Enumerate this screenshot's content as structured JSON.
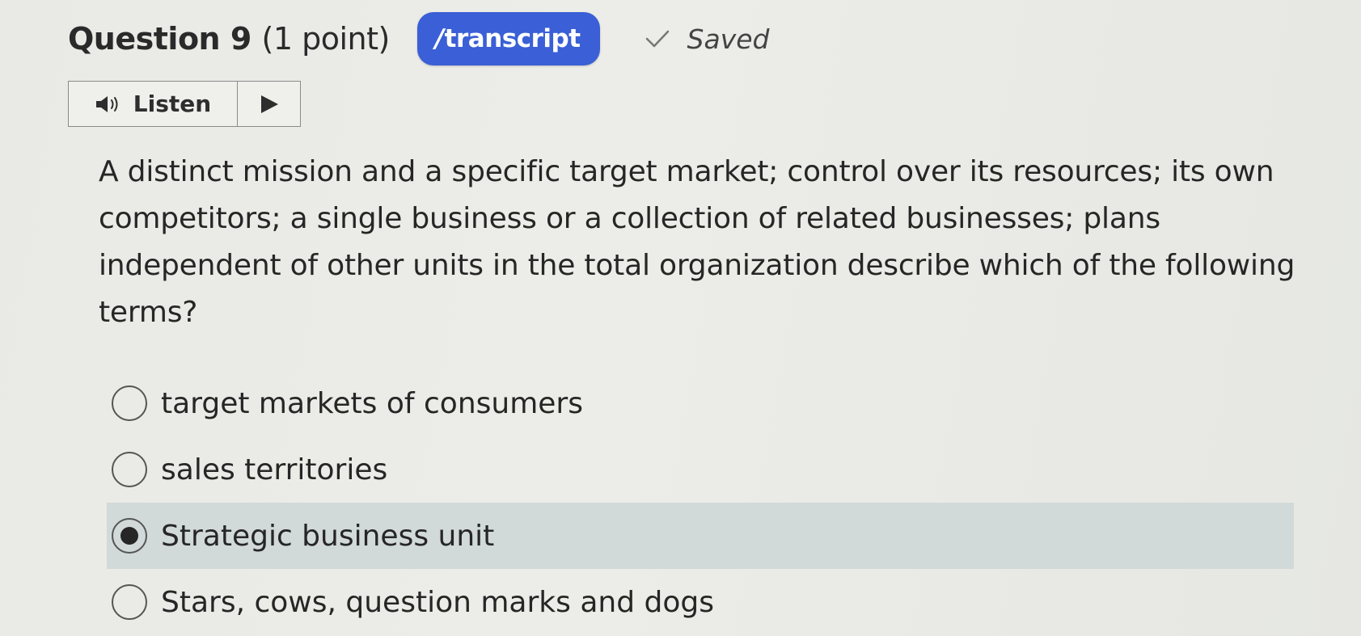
{
  "header": {
    "question_label": "Question 9",
    "points_label": "(1 point)",
    "transcript_label": "transcript",
    "saved_label": "Saved"
  },
  "listen": {
    "label": "Listen"
  },
  "question": {
    "text": "A distinct mission and a specific target market; control over its resources; its own competitors; a single business or a collection of related businesses; plans independent of other units in the total organization describe which of the following terms?"
  },
  "options": [
    {
      "label": "target markets of consumers",
      "selected": false
    },
    {
      "label": "sales territories",
      "selected": false
    },
    {
      "label": "Strategic business unit",
      "selected": true
    },
    {
      "label": "Stars, cows, question marks and dogs",
      "selected": false
    }
  ],
  "colors": {
    "transcript_badge": "#3a5fd6",
    "selected_option_bg": "#d2d9d9"
  },
  "icons": {
    "listen": "speaker-icon",
    "play": "play-icon",
    "saved": "checkmark-icon"
  }
}
